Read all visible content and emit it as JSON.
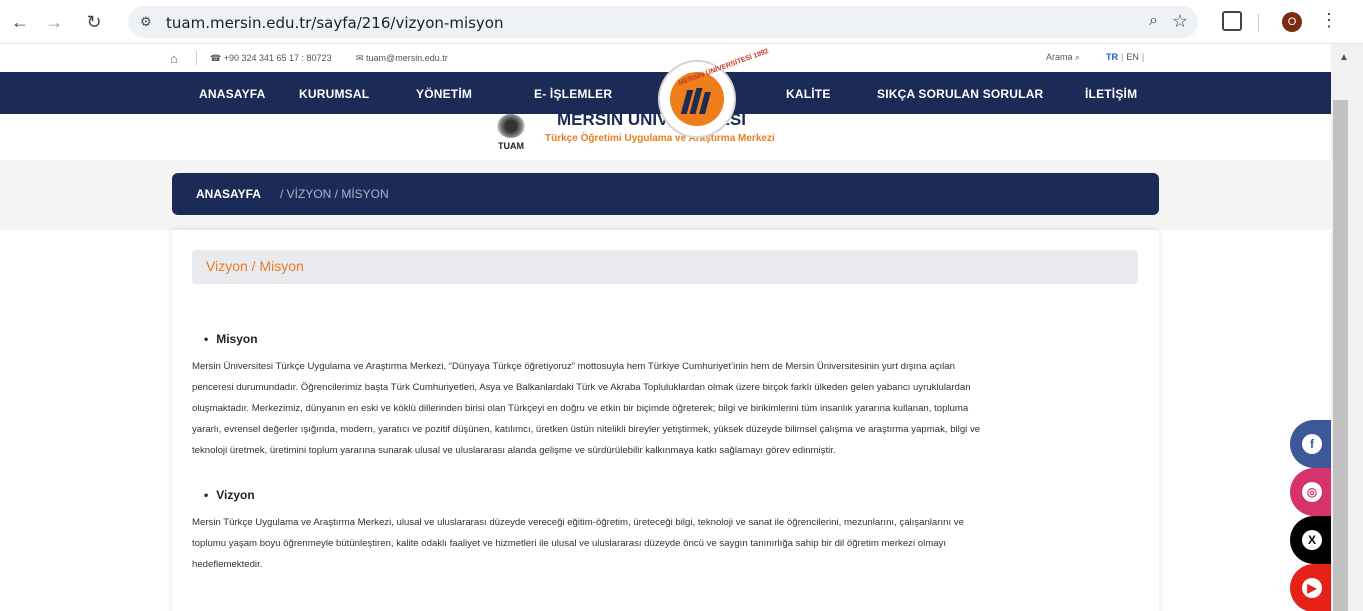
{
  "browser": {
    "url": "tuam.mersin.edu.tr/sayfa/216/vizyon-misyon",
    "profile_initial": "O"
  },
  "topbar": {
    "phone": "+90 324 341 65 17 : 80723",
    "email": "tuam@mersin.edu.tr",
    "search_label": "Arama",
    "lang_tr": "TR",
    "lang_en": "EN"
  },
  "nav": {
    "items": [
      "ANASAYFA",
      "KURUMSAL",
      "YÖNETİM",
      "E- İŞLEMLER",
      "KALİTE",
      "SIKÇA SORULAN SORULAR",
      "İLETİŞİM"
    ]
  },
  "logo": {
    "ring_text": "MERSİN ÜNİVERSİTESİ 1992",
    "university": "MERSİN ÜNİVERSİTESİ",
    "tuam_label": "TUAM",
    "center_name": "Türkçe Öğretimi Uygulama ve Araştırma Merkezi"
  },
  "breadcrumb": {
    "home": "ANASAYFA",
    "rest": "/ VİZYON / MİSYON"
  },
  "content": {
    "title": "Vizyon / Misyon",
    "mission_heading": "Misyon",
    "mission_lines": [
      "Mersin Üniversitesi Türkçe Uygulama ve Araştırma Merkezi, “Dünyaya Türkçe öğretiyoruz” mottosuyla hem Türkiye Cumhuriyet’inin hem de Mersin Üniversitesinin yurt dışına açılan",
      "penceresi durumundadır. Öğrencilerimiz başta Türk Cumhuriyetleri, Asya ve Balkanlardaki Türk ve Akraba Topluluklardan olmak üzere birçok farklı ülkeden gelen yabancı uyruklulardan",
      "oluşmaktadır.  Merkezimiz, dünyanın en eski ve köklü dillerinden birisi olan Türkçeyi en doğru ve etkin bir biçimde öğreterek; bilgi ve birikimlerini tüm insanlık yararına kullanan, topluma",
      "yararlı, evrensel değerler ışığında, modern, yaratıcı ve pozitif düşünen, katılımcı, üretken üstün nitelikli bireyler yetiştirmek, yüksek düzeyde bilimsel çalışma ve araştırma yapmak, bilgi ve",
      "teknoloji üretmek, üretimini toplum yararına sunarak ulusal ve uluslararası alanda gelişme ve sürdürülebilir kalkınmaya katkı sağlamayı görev edinmiştir."
    ],
    "vision_heading": "Vizyon",
    "vision_lines": [
      "Mersin Türkçe Uygulama ve Araştırma Merkezi, ulusal ve uluslararası düzeyde vereceği eğitim-öğretim, üreteceği bilgi, teknoloji ve sanat ile öğrencilerini, mezunlarını, çalışanlarını ve",
      "toplumu yaşam boyu öğrenmeyle bütünleştiren, kalite odaklı faaliyet ve hizmetleri ile ulusal ve uluslararası düzeyde öncü ve saygın tanınırlığa sahip bir dil öğretim merkezi olmayı",
      "hedeflemektedir."
    ]
  },
  "social": [
    {
      "name": "facebook",
      "glyph": "f",
      "color": "#3b5998",
      "icon_color": "#3b5998"
    },
    {
      "name": "instagram",
      "glyph": "◎",
      "color": "#d6336c",
      "icon_color": "#d6336c"
    },
    {
      "name": "x",
      "glyph": "X",
      "color": "#000000",
      "icon_color": "#000000"
    },
    {
      "name": "youtube",
      "glyph": "▶",
      "color": "#e62117",
      "icon_color": "#e62117"
    }
  ]
}
